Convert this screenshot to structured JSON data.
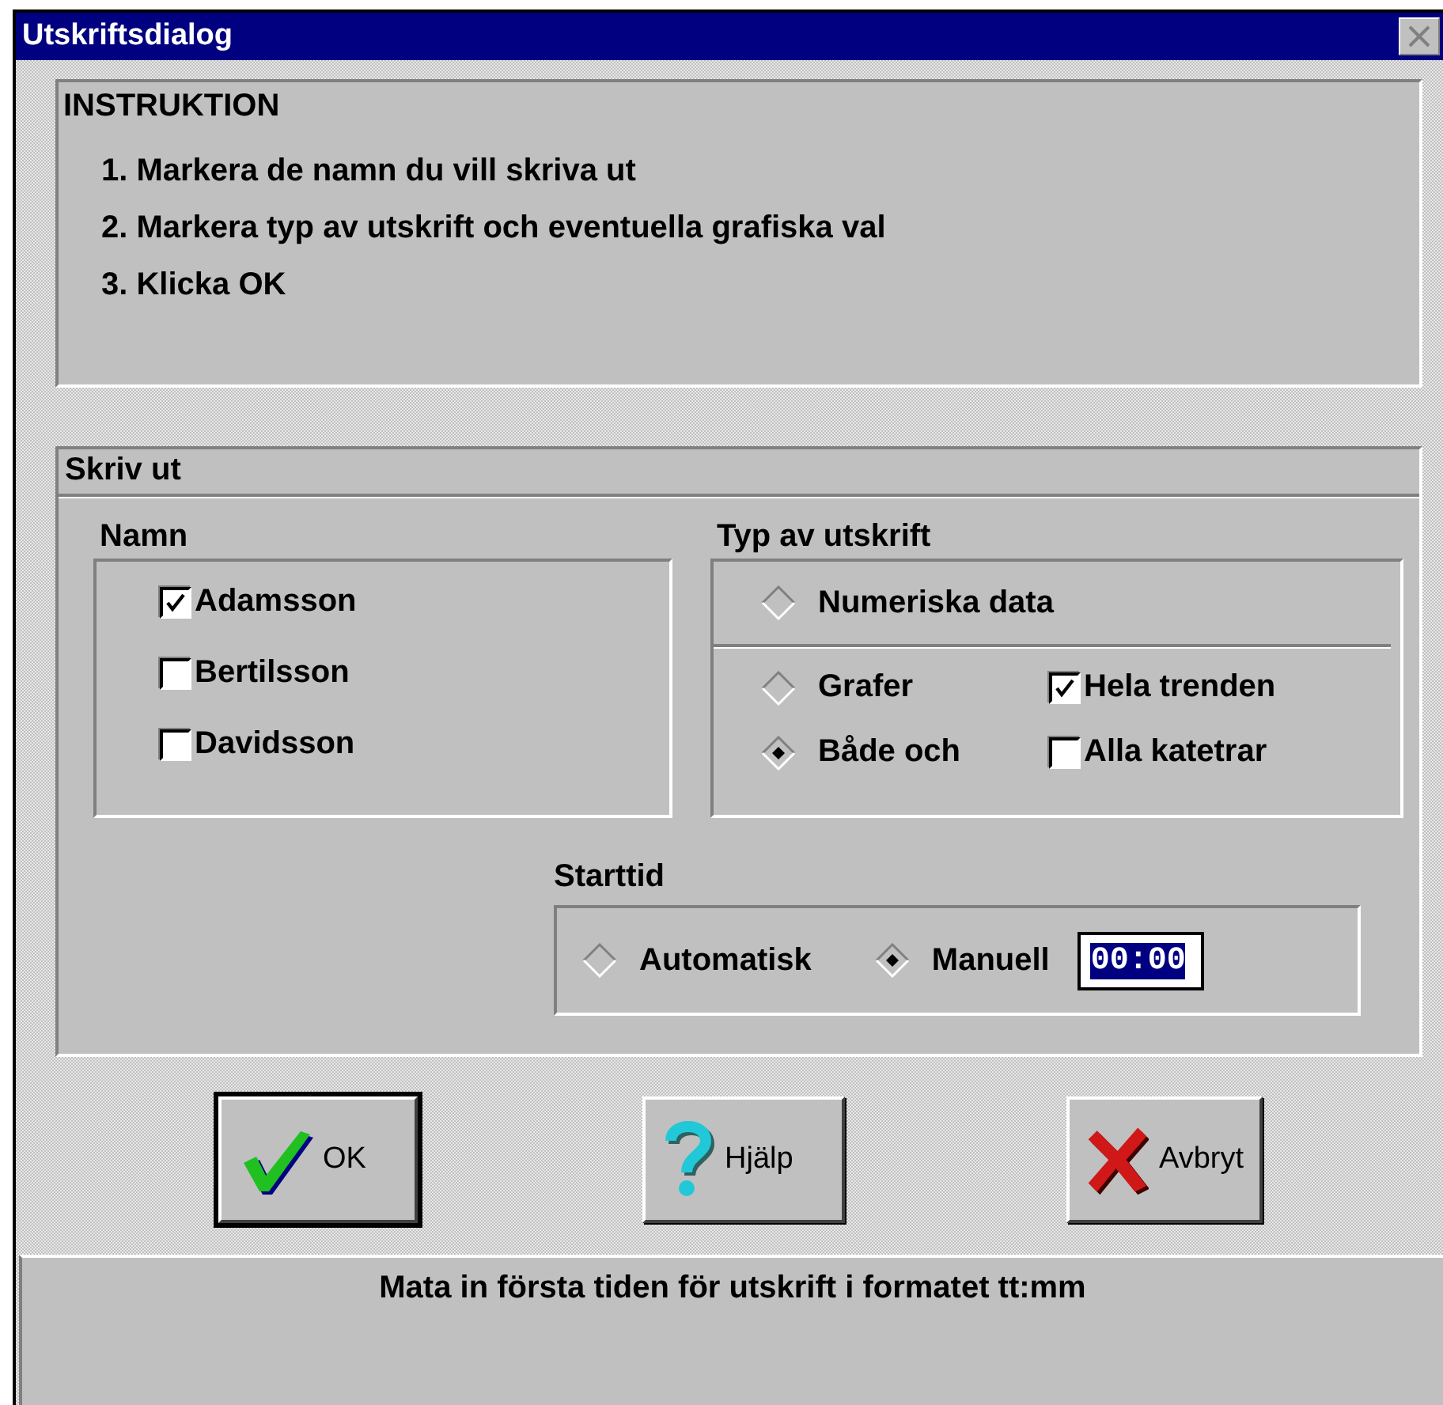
{
  "window": {
    "title": "Utskriftsdialog"
  },
  "instructions": {
    "heading": "INSTRUKTION",
    "steps": [
      "1. Markera de namn du vill skriva ut",
      "2. Markera typ av utskrift och eventuella grafiska val",
      "3. Klicka OK"
    ]
  },
  "print": {
    "title": "Skriv ut",
    "names": {
      "label": "Namn",
      "items": [
        {
          "label": "Adamsson",
          "checked": true
        },
        {
          "label": "Bertilsson",
          "checked": false
        },
        {
          "label": "Davidsson",
          "checked": false
        }
      ]
    },
    "type": {
      "label": "Typ av utskrift",
      "options": [
        {
          "label": "Numeriska data",
          "selected": false
        },
        {
          "label": "Grafer",
          "selected": false
        },
        {
          "label": "Både och",
          "selected": true
        }
      ],
      "graphics": [
        {
          "label": "Hela trenden",
          "checked": true
        },
        {
          "label": "Alla katetrar",
          "checked": false
        }
      ]
    },
    "start": {
      "label": "Starttid",
      "options": [
        {
          "label": "Automatisk",
          "selected": false
        },
        {
          "label": "Manuell",
          "selected": true
        }
      ],
      "time": "00:00"
    }
  },
  "buttons": [
    {
      "kind": "ok",
      "label": "OK",
      "default": true
    },
    {
      "kind": "help",
      "label": "Hjälp",
      "default": false
    },
    {
      "kind": "cancel",
      "label": "Avbryt",
      "default": false
    }
  ],
  "status_bar": "Mata in första tiden för utskrift i formatet tt:mm"
}
